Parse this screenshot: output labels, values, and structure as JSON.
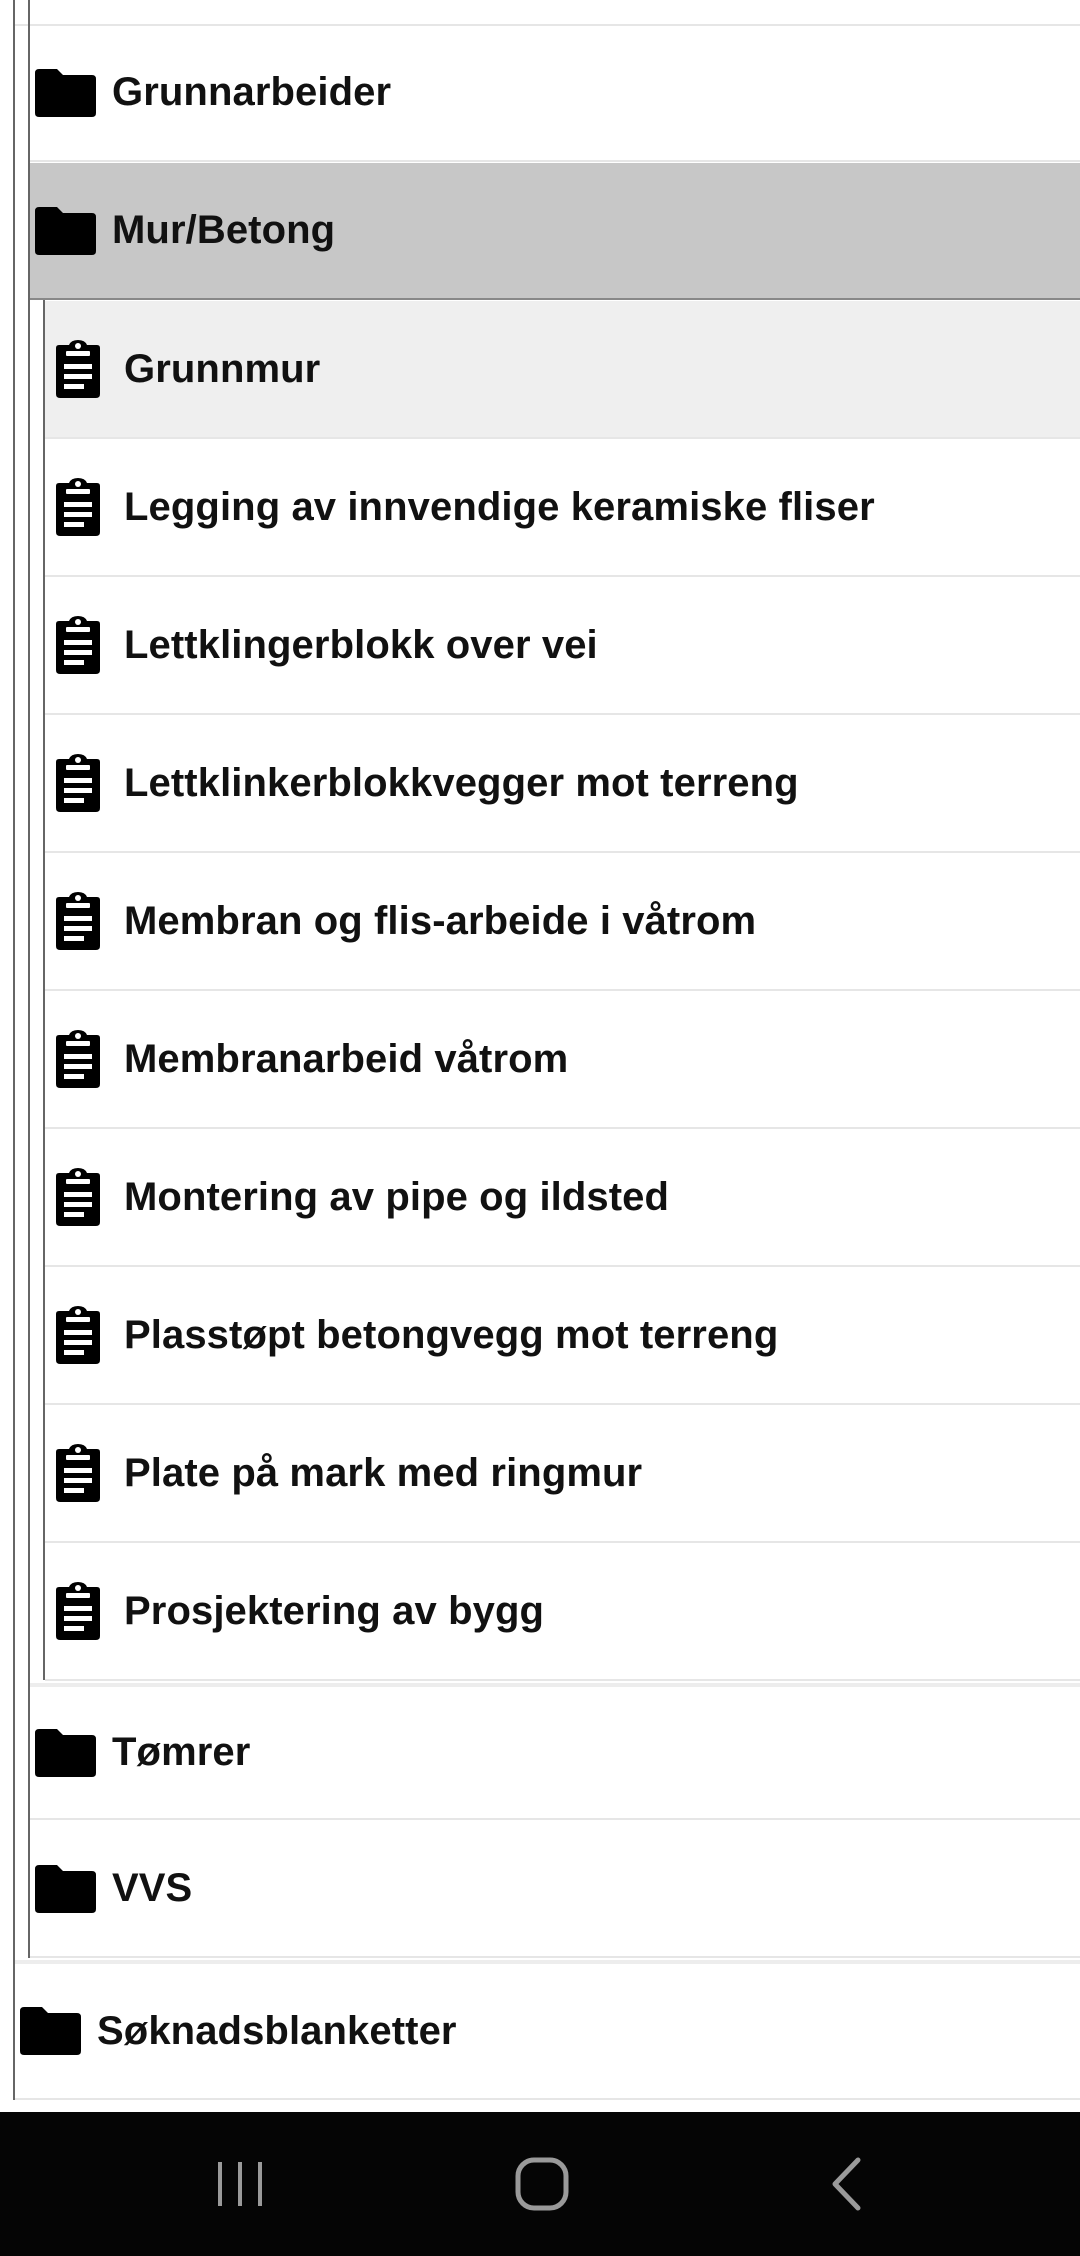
{
  "tree": {
    "subfolders_top": [
      {
        "label": "Grunnarbeider",
        "icon": "folder-icon"
      },
      {
        "label": "Mur/Betong",
        "icon": "folder-icon",
        "selected": true
      }
    ],
    "documents": [
      {
        "label": "Grunnmur",
        "icon": "clipboard-icon",
        "selected": true
      },
      {
        "label": "Legging av innvendige keramiske fliser",
        "icon": "clipboard-icon"
      },
      {
        "label": "Lettklingerblokk over vei",
        "icon": "clipboard-icon"
      },
      {
        "label": "Lettklinkerblokkvegger mot terreng",
        "icon": "clipboard-icon"
      },
      {
        "label": "Membran og flis-arbeide i våtrom",
        "icon": "clipboard-icon"
      },
      {
        "label": "Membranarbeid våtrom",
        "icon": "clipboard-icon"
      },
      {
        "label": "Montering av pipe og ildsted",
        "icon": "clipboard-icon"
      },
      {
        "label": "Plasstøpt betongvegg mot terreng",
        "icon": "clipboard-icon"
      },
      {
        "label": "Plate på mark med ringmur",
        "icon": "clipboard-icon"
      },
      {
        "label": "Prosjektering av bygg",
        "icon": "clipboard-icon"
      }
    ],
    "subfolders_bottom": [
      {
        "label": "Tømrer",
        "icon": "folder-icon"
      },
      {
        "label": "VVS",
        "icon": "folder-icon"
      }
    ],
    "root_folder": {
      "label": "Søknadsblanketter",
      "icon": "folder-icon"
    }
  },
  "navbar": {
    "buttons": [
      "recent-apps-icon",
      "home-icon",
      "back-icon"
    ]
  },
  "colors": {
    "selected_folder_bg": "#c7c7c7",
    "selected_item_bg": "#efefef",
    "navbar_bg": "#050505"
  }
}
